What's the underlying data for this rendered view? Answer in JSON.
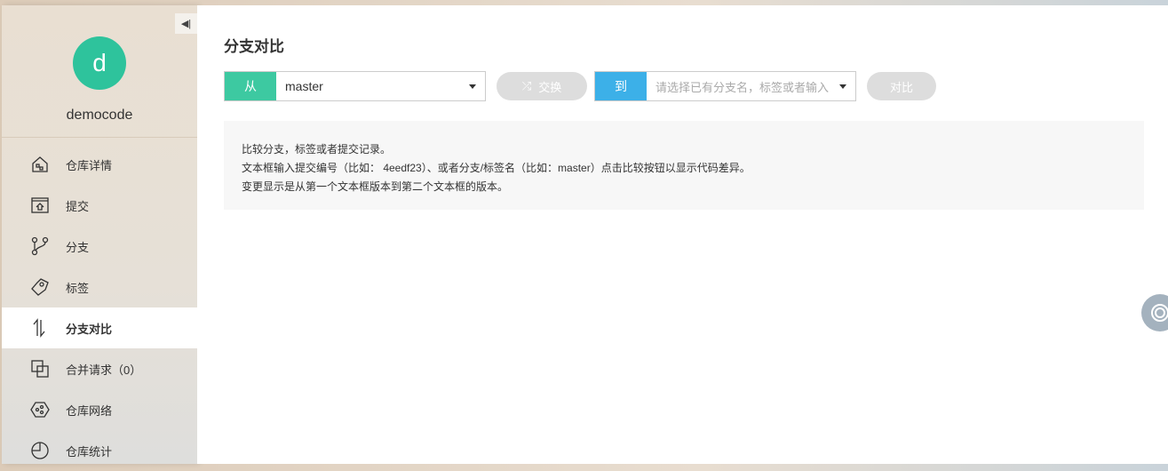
{
  "sidebar": {
    "repo_name": "democode",
    "avatar_letter": "d",
    "collapse_icon": "◀|",
    "items": [
      {
        "label": "仓库详情",
        "icon": "house-icon"
      },
      {
        "label": "提交",
        "icon": "commit-icon"
      },
      {
        "label": "分支",
        "icon": "branch-icon"
      },
      {
        "label": "标签",
        "icon": "tag-icon"
      },
      {
        "label": "分支对比",
        "icon": "compare-icon",
        "active": true
      },
      {
        "label": "合并请求（0）",
        "icon": "merge-icon"
      },
      {
        "label": "仓库网络",
        "icon": "network-icon"
      },
      {
        "label": "仓库统计",
        "icon": "pie-icon"
      }
    ]
  },
  "main": {
    "title": "分支对比",
    "from": {
      "label": "从",
      "value": "master",
      "color": "#3dc9a1"
    },
    "swap_label": "交换",
    "to": {
      "label": "到",
      "placeholder": "请选择已有分支名，标签或者输入",
      "color": "#3cb0e8"
    },
    "compare_label": "对比",
    "info": [
      "比较分支，标签或者提交记录。",
      "文本框输入提交编号（比如： 4eedf23）、或者分支/标签名（比如：master）点击比较按钮以显示代码差异。",
      "变更显示是从第一个文本框版本到第二个文本框的版本。"
    ]
  }
}
